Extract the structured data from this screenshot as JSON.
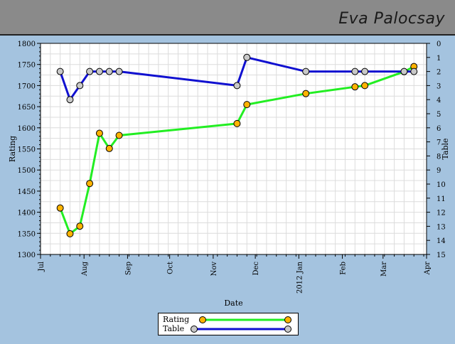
{
  "header": {
    "name": "Eva Palocsay",
    "bg": "#8a8a8a"
  },
  "chart_data": {
    "type": "line",
    "xlabel": "Date",
    "ylabel_left": "Rating",
    "ylabel_right": "Table",
    "x_ticks": [
      "Jul",
      "Aug",
      "Sep",
      "Oct",
      "Nov",
      "Dec",
      "2012 Jan",
      "Feb",
      "Mar",
      "Apr"
    ],
    "ylim_left": [
      1300,
      1800
    ],
    "ylim_right": [
      15,
      0
    ],
    "y_ticks_left": [
      1300,
      1350,
      1400,
      1450,
      1500,
      1550,
      1600,
      1650,
      1700,
      1750,
      1800
    ],
    "y_ticks_right": [
      0,
      1,
      2,
      3,
      4,
      5,
      6,
      7,
      8,
      9,
      10,
      11,
      12,
      13,
      14,
      15
    ],
    "grid": true,
    "legend_position": "bottom",
    "series": [
      {
        "name": "Rating",
        "axis": "left",
        "color": "#22ee22",
        "marker_color": "#ffb300",
        "points": [
          {
            "x": "2011-07-15",
            "y": 1410
          },
          {
            "x": "2011-07-22",
            "y": 1349
          },
          {
            "x": "2011-07-29",
            "y": 1367
          },
          {
            "x": "2011-08-05",
            "y": 1468
          },
          {
            "x": "2011-08-12",
            "y": 1587
          },
          {
            "x": "2011-08-19",
            "y": 1551
          },
          {
            "x": "2011-08-26",
            "y": 1582
          },
          {
            "x": "2011-11-18",
            "y": 1610
          },
          {
            "x": "2011-11-25",
            "y": 1655
          },
          {
            "x": "2012-01-06",
            "y": 1681
          },
          {
            "x": "2012-02-10",
            "y": 1697
          },
          {
            "x": "2012-02-17",
            "y": 1700
          },
          {
            "x": "2012-03-16",
            "y": 1733
          },
          {
            "x": "2012-03-23",
            "y": 1745
          }
        ]
      },
      {
        "name": "Table",
        "axis": "right",
        "color": "#1010d0",
        "marker_color": "#c8c8c8",
        "points": [
          {
            "x": "2011-07-15",
            "y": 2
          },
          {
            "x": "2011-07-22",
            "y": 4
          },
          {
            "x": "2011-07-29",
            "y": 3
          },
          {
            "x": "2011-08-05",
            "y": 2
          },
          {
            "x": "2011-08-12",
            "y": 2
          },
          {
            "x": "2011-08-19",
            "y": 2
          },
          {
            "x": "2011-08-26",
            "y": 2
          },
          {
            "x": "2011-11-18",
            "y": 3
          },
          {
            "x": "2011-11-25",
            "y": 1
          },
          {
            "x": "2012-01-06",
            "y": 2
          },
          {
            "x": "2012-02-10",
            "y": 2
          },
          {
            "x": "2012-02-17",
            "y": 2
          },
          {
            "x": "2012-03-16",
            "y": 2
          },
          {
            "x": "2012-03-23",
            "y": 2
          }
        ]
      }
    ]
  }
}
